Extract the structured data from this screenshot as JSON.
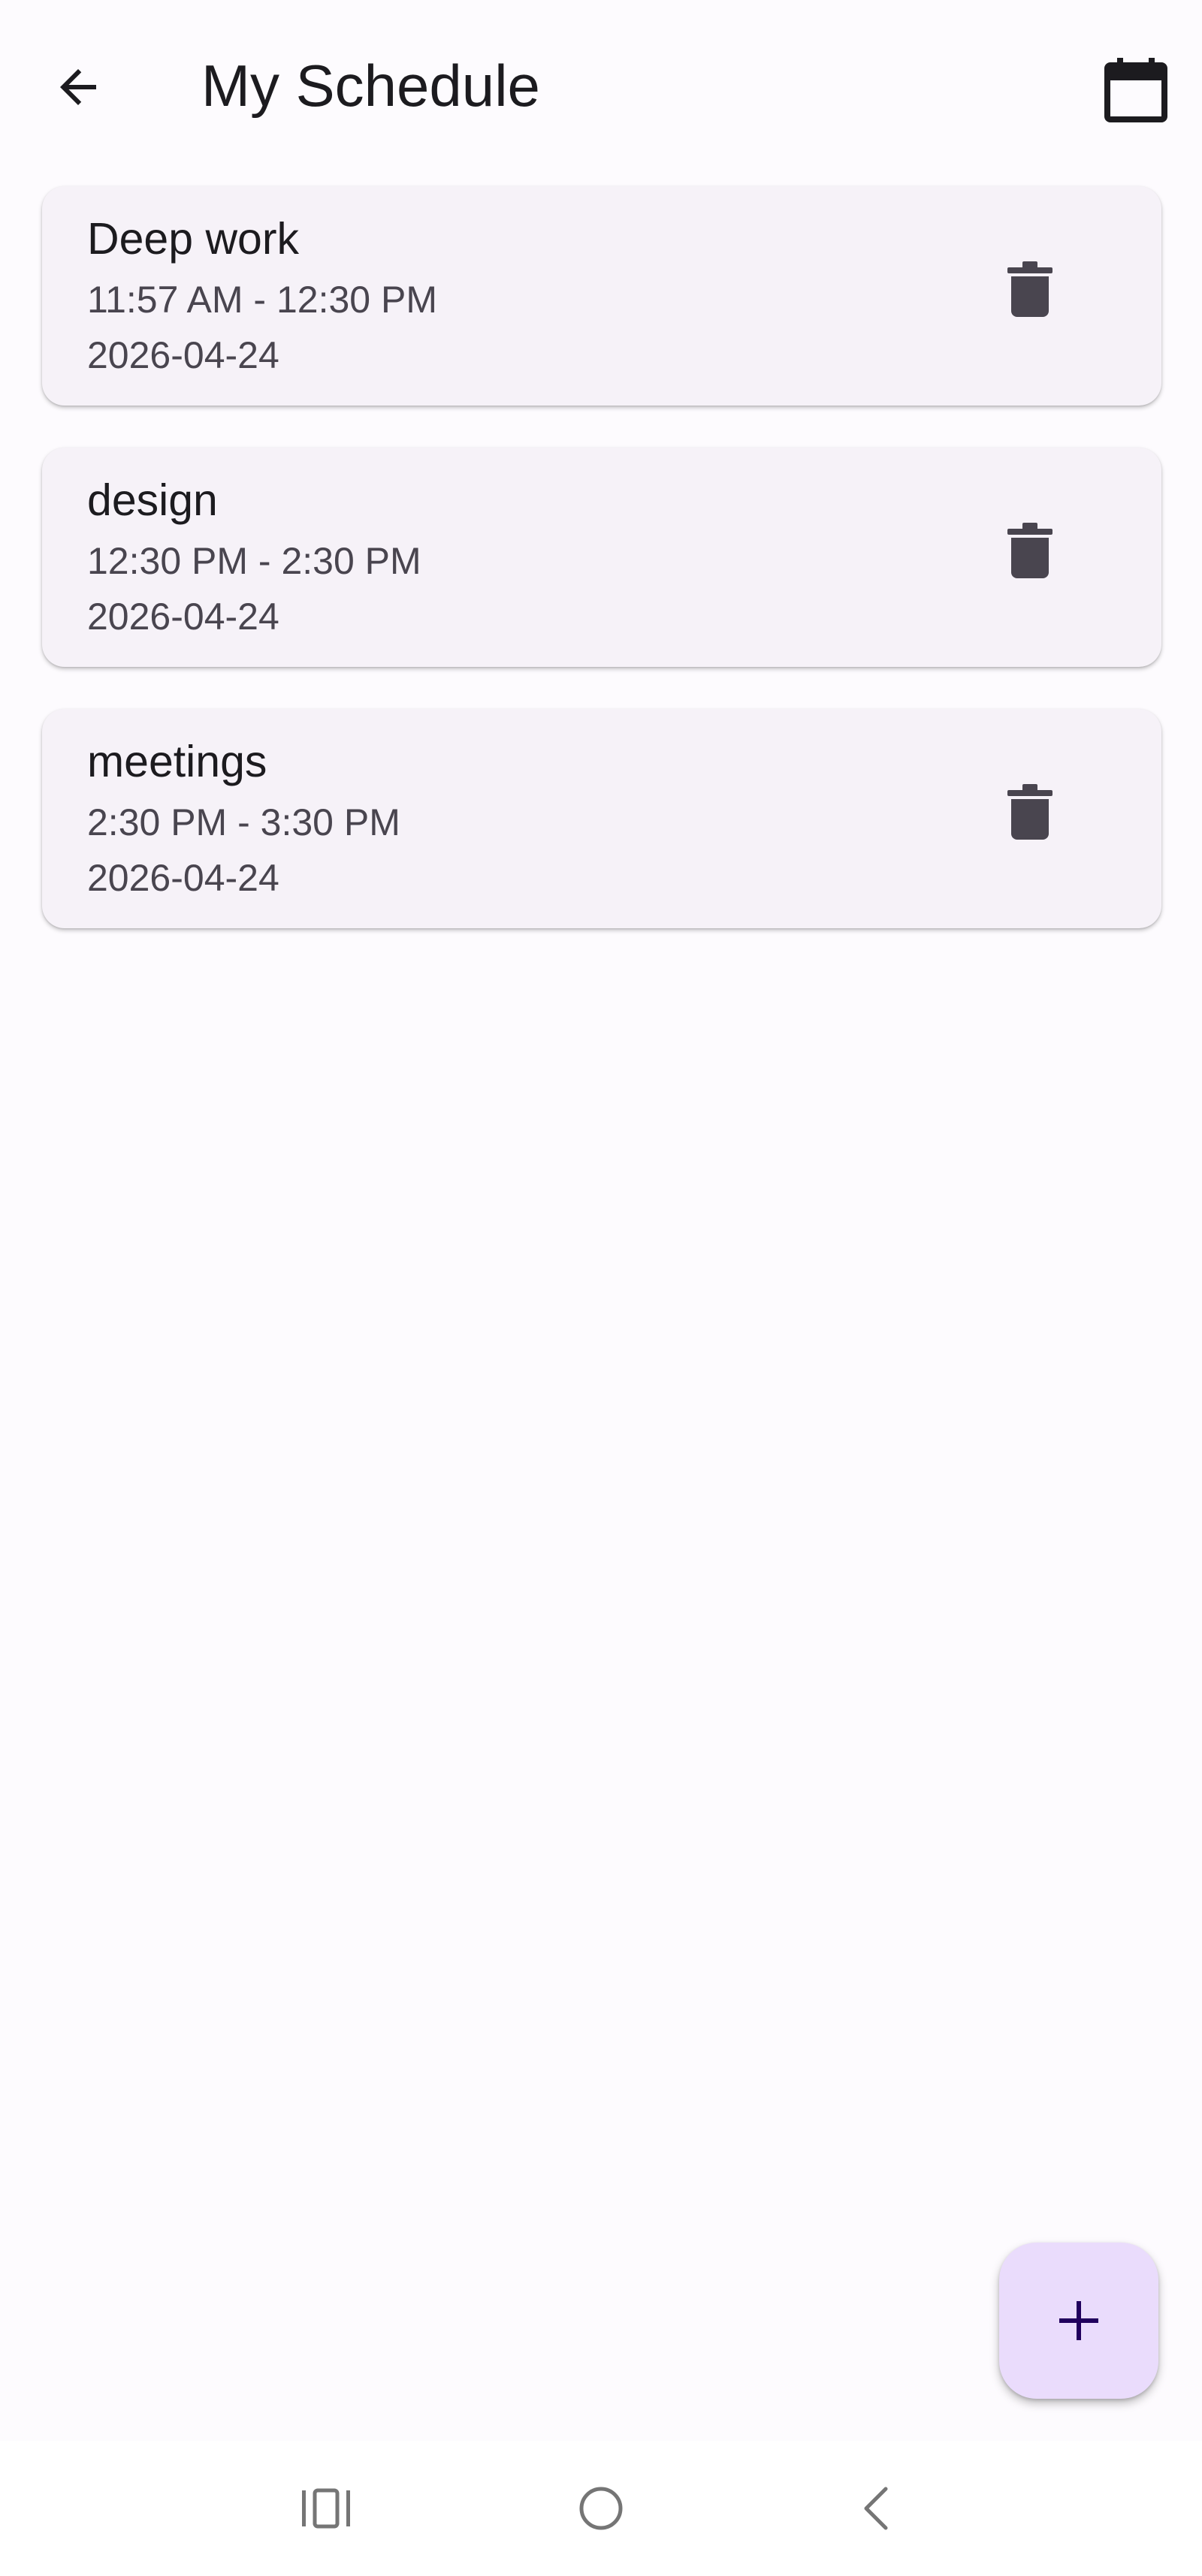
{
  "app_bar": {
    "title": "My Schedule",
    "back_icon": "arrow-back-icon",
    "calendar_icon": "calendar-icon"
  },
  "schedule": {
    "items": [
      {
        "title": "Deep work",
        "time": "11:57 AM - 12:30 PM",
        "date": "2026-04-24",
        "action_icon": "trash-icon"
      },
      {
        "title": "design",
        "time": "12:30 PM - 2:30 PM",
        "date": "2026-04-24",
        "action_icon": "trash-icon"
      },
      {
        "title": "meetings",
        "time": "2:30 PM - 3:30 PM",
        "date": "2026-04-24",
        "action_icon": "trash-icon"
      }
    ]
  },
  "fab": {
    "icon": "plus-icon"
  },
  "system_nav": {
    "recents_icon": "recents-icon",
    "home_icon": "home-icon",
    "back_icon": "system-back-icon"
  },
  "colors": {
    "background": "#fdfbfe",
    "card_background": "#f6f2f8",
    "fab_background": "#eadcfc",
    "icon_dark": "#49454f",
    "text_primary": "#1c1b1f",
    "text_secondary": "#49454f",
    "fab_icon": "#21005d"
  }
}
